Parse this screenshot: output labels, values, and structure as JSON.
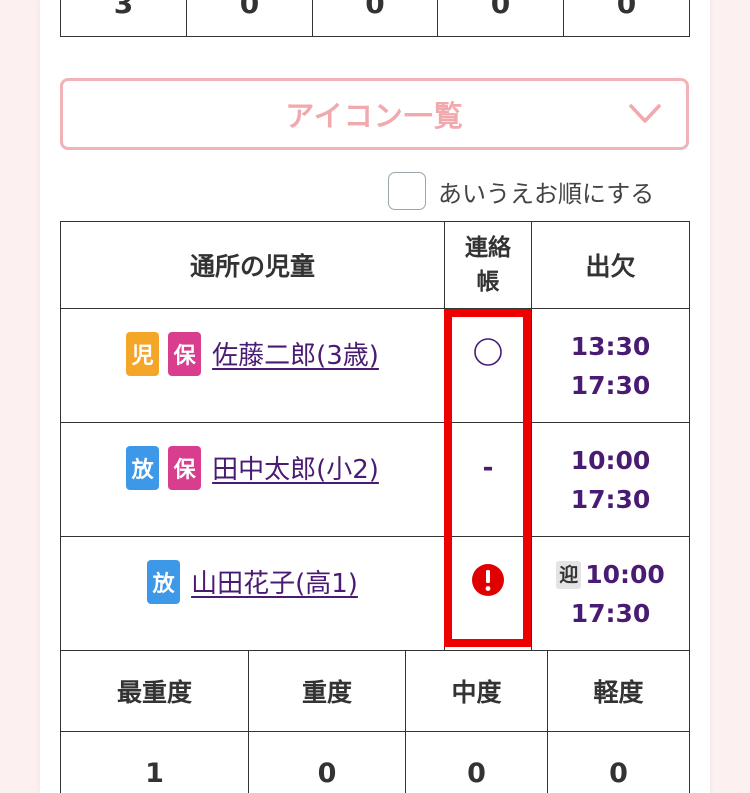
{
  "top_counts": [
    "3",
    "0",
    "0",
    "0",
    "0"
  ],
  "icon_list": {
    "label": "アイコン一覧"
  },
  "sort_option": {
    "label": "あいうえお順にする",
    "checked": false
  },
  "children_table": {
    "headers": {
      "children": "通所の児童",
      "contact_line1": "連絡",
      "contact_line2": "帳",
      "attendance": "出欠"
    },
    "rows": [
      {
        "badges": [
          {
            "text": "児",
            "color": "#f3a627"
          },
          {
            "text": "保",
            "color": "#d83e8d"
          }
        ],
        "name": "佐藤二郎(3歳)",
        "contact_icon": "circle-icon",
        "contact_text": "",
        "pickup": "",
        "time_in": "13:30",
        "time_out": "17:30"
      },
      {
        "badges": [
          {
            "text": "放",
            "color": "#3e98e8"
          },
          {
            "text": "保",
            "color": "#d83e8d"
          }
        ],
        "name": "田中太郎(小2)",
        "contact_icon": "",
        "contact_text": "-",
        "pickup": "",
        "time_in": "10:00",
        "time_out": "17:30"
      },
      {
        "badges": [
          {
            "text": "放",
            "color": "#3e98e8"
          }
        ],
        "name": "山田花子(高1)",
        "contact_icon": "exclamation-icon",
        "contact_text": "",
        "pickup": "迎",
        "time_in": "10:00",
        "time_out": "17:30"
      }
    ]
  },
  "severity_table": {
    "headers": [
      "最重度",
      "重度",
      "中度",
      "軽度"
    ],
    "values": [
      "1",
      "0",
      "0",
      "0"
    ]
  },
  "colors": {
    "accent_pink": "#f1b3b5",
    "link_purple": "#4a1b73",
    "highlight_red": "#ee0000",
    "alert_red": "#e00000"
  }
}
